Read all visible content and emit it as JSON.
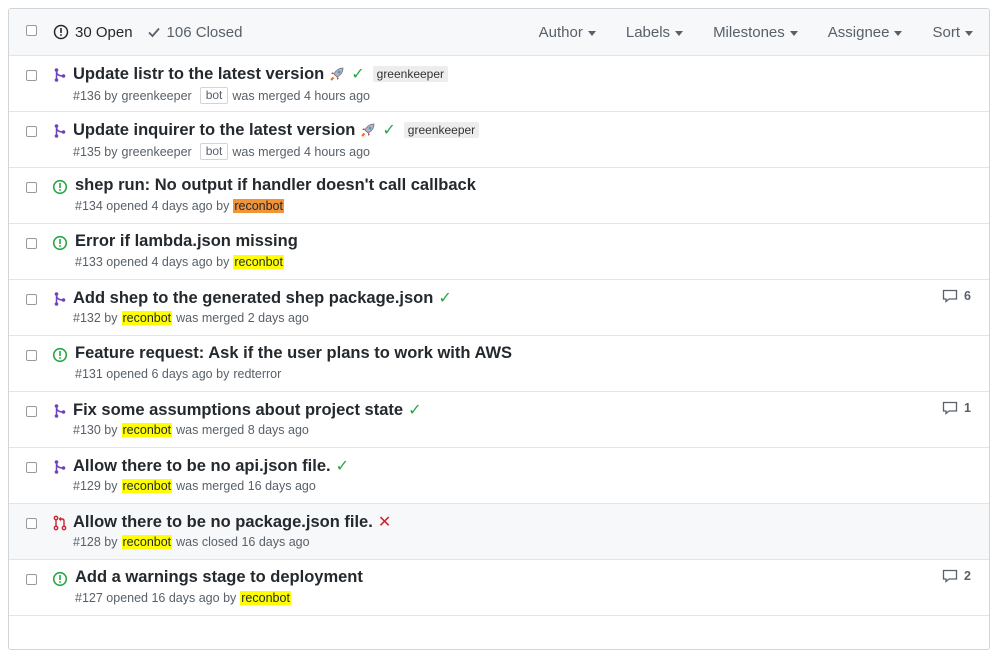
{
  "header": {
    "open_label": "30 Open",
    "closed_label": "106 Closed",
    "filters": [
      "Author",
      "Labels",
      "Milestones",
      "Assignee",
      "Sort"
    ]
  },
  "colors": {
    "merged": "#6f42c1",
    "open": "#28a745",
    "closed": "#cb2431",
    "check": "#28a745"
  },
  "rows": [
    {
      "title": "Update listr to the latest version",
      "label": "greenkeeper",
      "number": "#136",
      "by": "by",
      "author": "greenkeeper",
      "bot": "bot",
      "status_text": "was merged 4 hours ago"
    },
    {
      "title": "Update inquirer to the latest version",
      "label": "greenkeeper",
      "number": "#135",
      "by": "by",
      "author": "greenkeeper",
      "bot": "bot",
      "status_text": "was merged 4 hours ago"
    },
    {
      "title": "shep run: No output if handler doesn't call callback",
      "number": "#134",
      "opened": "opened 4 days ago by",
      "author": "reconbot"
    },
    {
      "title": "Error if lambda.json missing",
      "number": "#133",
      "opened": "opened 4 days ago by",
      "author": "reconbot"
    },
    {
      "title": "Add shep to the generated shep package.json",
      "number": "#132",
      "by": "by",
      "author": "reconbot",
      "status_text": "was merged 2 days ago",
      "comments": "6"
    },
    {
      "title": "Feature request: Ask if the user plans to work with AWS",
      "number": "#131",
      "opened": "opened 6 days ago by",
      "author": "redterror"
    },
    {
      "title": "Fix some assumptions about project state",
      "number": "#130",
      "by": "by",
      "author": "reconbot",
      "status_text": "was merged 8 days ago",
      "comments": "1"
    },
    {
      "title": "Allow there to be no api.json file.",
      "number": "#129",
      "by": "by",
      "author": "reconbot",
      "status_text": "was merged 16 days ago"
    },
    {
      "title": "Allow there to be no package.json file.",
      "number": "#128",
      "by": "by",
      "author": "reconbot",
      "status_text": "was closed 16 days ago"
    },
    {
      "title": "Add a warnings stage to deployment",
      "number": "#127",
      "opened": "opened 16 days ago by",
      "author": "reconbot",
      "comments": "2"
    }
  ]
}
